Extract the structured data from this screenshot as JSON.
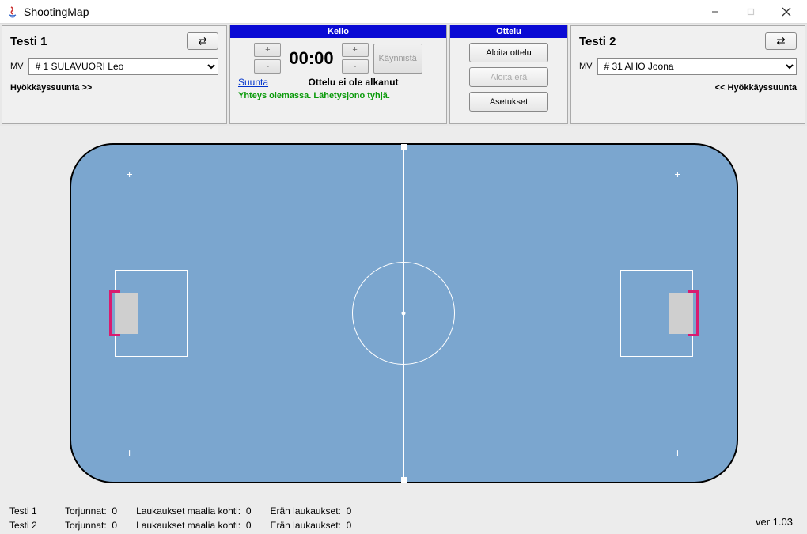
{
  "titlebar": {
    "app_name": "ShootingMap"
  },
  "team_left": {
    "name": "Testi 1",
    "mv_label": "MV",
    "mv_value": "# 1 SULAVUORI Leo",
    "attack_dir": "Hyökkäyssuunta >>",
    "swap_icon": "⇄"
  },
  "team_right": {
    "name": "Testi 2",
    "mv_label": "MV",
    "mv_value": "# 31 AHO Joona",
    "attack_dir": "<< Hyökkäyssuunta",
    "swap_icon": "⇄"
  },
  "clock": {
    "header": "Kello",
    "plus": "+",
    "minus": "-",
    "time": "00:00",
    "start_label": "Käynnistä",
    "suunta_link": "Suunta",
    "status": "Ottelu ei ole alkanut",
    "connection": "Yhteys olemassa. Lähetysjono tyhjä."
  },
  "match": {
    "header": "Ottelu",
    "start_match": "Aloita ottelu",
    "start_period": "Aloita erä",
    "settings": "Asetukset"
  },
  "stats": {
    "team1_label": "Testi 1",
    "team2_label": "Testi 2",
    "saves_label": "Torjunnat:",
    "sog_label": "Laukaukset maalia kohti:",
    "period_label": "Erän laukaukset:",
    "team1_saves": "0",
    "team1_sog": "0",
    "team1_period": "0",
    "team2_saves": "0",
    "team2_sog": "0",
    "team2_period": "0"
  },
  "version": "ver 1.03"
}
